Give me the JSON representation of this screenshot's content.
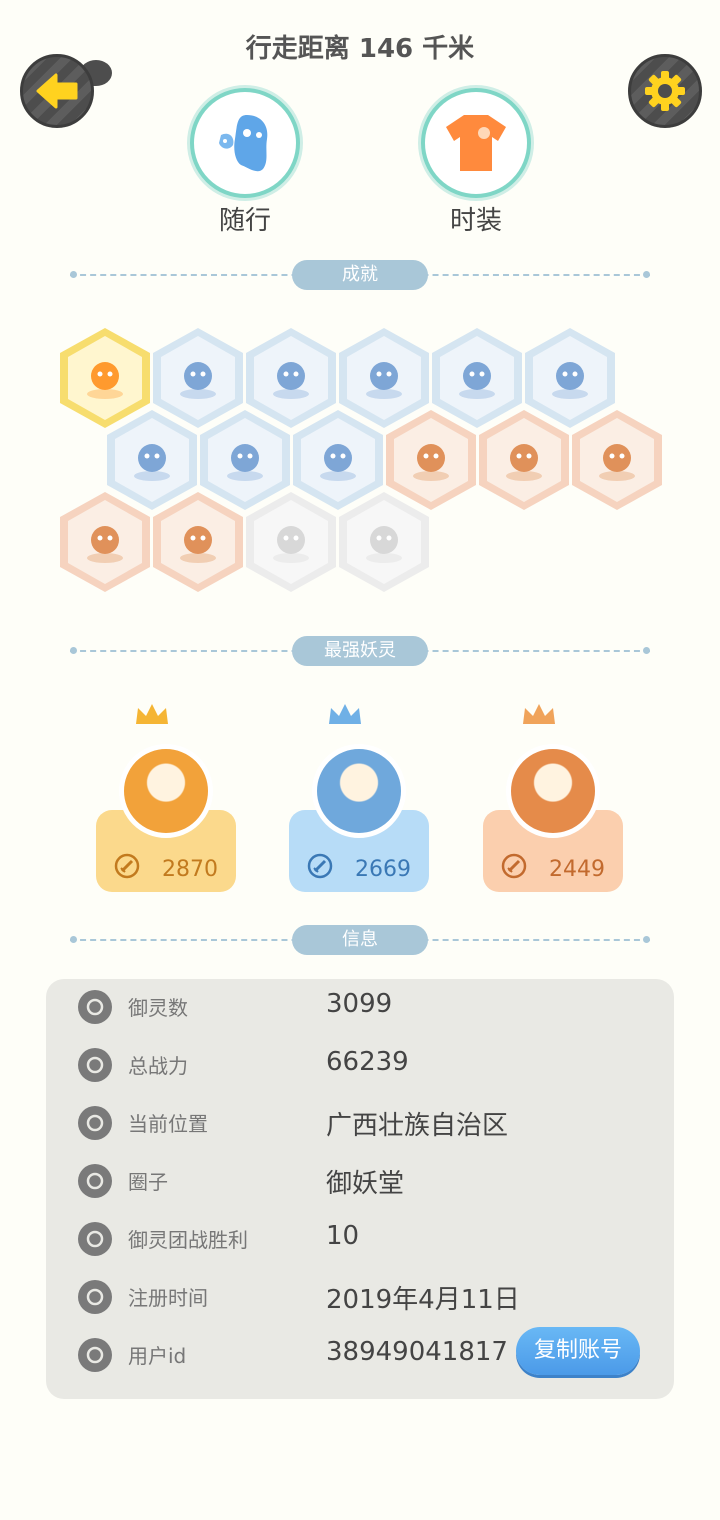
{
  "header": {
    "title": "行走距离 146 千米",
    "back_icon": "arrow-left-icon",
    "settings_icon": "gear-icon"
  },
  "top_buttons": {
    "companion_label": "随行",
    "fashion_label": "时装"
  },
  "sections": {
    "achievements": "成就",
    "strongest": "最强妖灵",
    "info": "信息"
  },
  "achievement_badges": [
    {
      "icon": "fox-spirit-icon",
      "color": "gold"
    },
    {
      "icon": "shoe-icon",
      "color": "blue"
    },
    {
      "icon": "target-map-icon",
      "color": "blue"
    },
    {
      "icon": "moon-icon",
      "color": "blue"
    },
    {
      "icon": "mushroom-icon",
      "color": "blue"
    },
    {
      "icon": "spirit-statue-icon",
      "color": "blue"
    },
    {
      "icon": "cart-icon",
      "color": "blue"
    },
    {
      "icon": "cat-spirit-icon",
      "color": "blue"
    },
    {
      "icon": "yin-yang-icon",
      "color": "blue"
    },
    {
      "icon": "crystal-icon",
      "color": "orange"
    },
    {
      "icon": "yin-yang-swirl-icon",
      "color": "orange"
    },
    {
      "icon": "shield-banner-icon",
      "color": "orange"
    },
    {
      "icon": "demon-statue-icon",
      "color": "orange"
    },
    {
      "icon": "dog-statue-icon",
      "color": "orange"
    },
    {
      "icon": "tree-spirit-icon",
      "color": "grey"
    },
    {
      "icon": "book-spirit-icon",
      "color": "grey"
    }
  ],
  "strongest_spirits": [
    {
      "power": "2870",
      "card_color": "#fbd98c",
      "text_color": "#c27a1e",
      "crown": "gold"
    },
    {
      "power": "2669",
      "card_color": "#b7dcf7",
      "text_color": "#3a78b5",
      "crown": "blue"
    },
    {
      "power": "2449",
      "card_color": "#fbcfae",
      "text_color": "#c26a2e",
      "crown": "orange"
    }
  ],
  "info": {
    "rows": [
      {
        "icon": "spirit-count-icon",
        "label": "御灵数",
        "value": "3099"
      },
      {
        "icon": "sword-icon",
        "label": "总战力",
        "value": "66239"
      },
      {
        "icon": "location-icon",
        "label": "当前位置",
        "value": "广西壮族自治区"
      },
      {
        "icon": "circle-icon",
        "label": "圈子",
        "value": "御妖堂"
      },
      {
        "icon": "team-battle-icon",
        "label": "御灵团战胜利",
        "value": "10"
      },
      {
        "icon": "clock-icon",
        "label": "注册时间",
        "value": "2019年4月11日"
      },
      {
        "icon": "id-card-icon",
        "label": "用户id",
        "value": "38949041817"
      }
    ],
    "copy_button": "复制账号"
  }
}
